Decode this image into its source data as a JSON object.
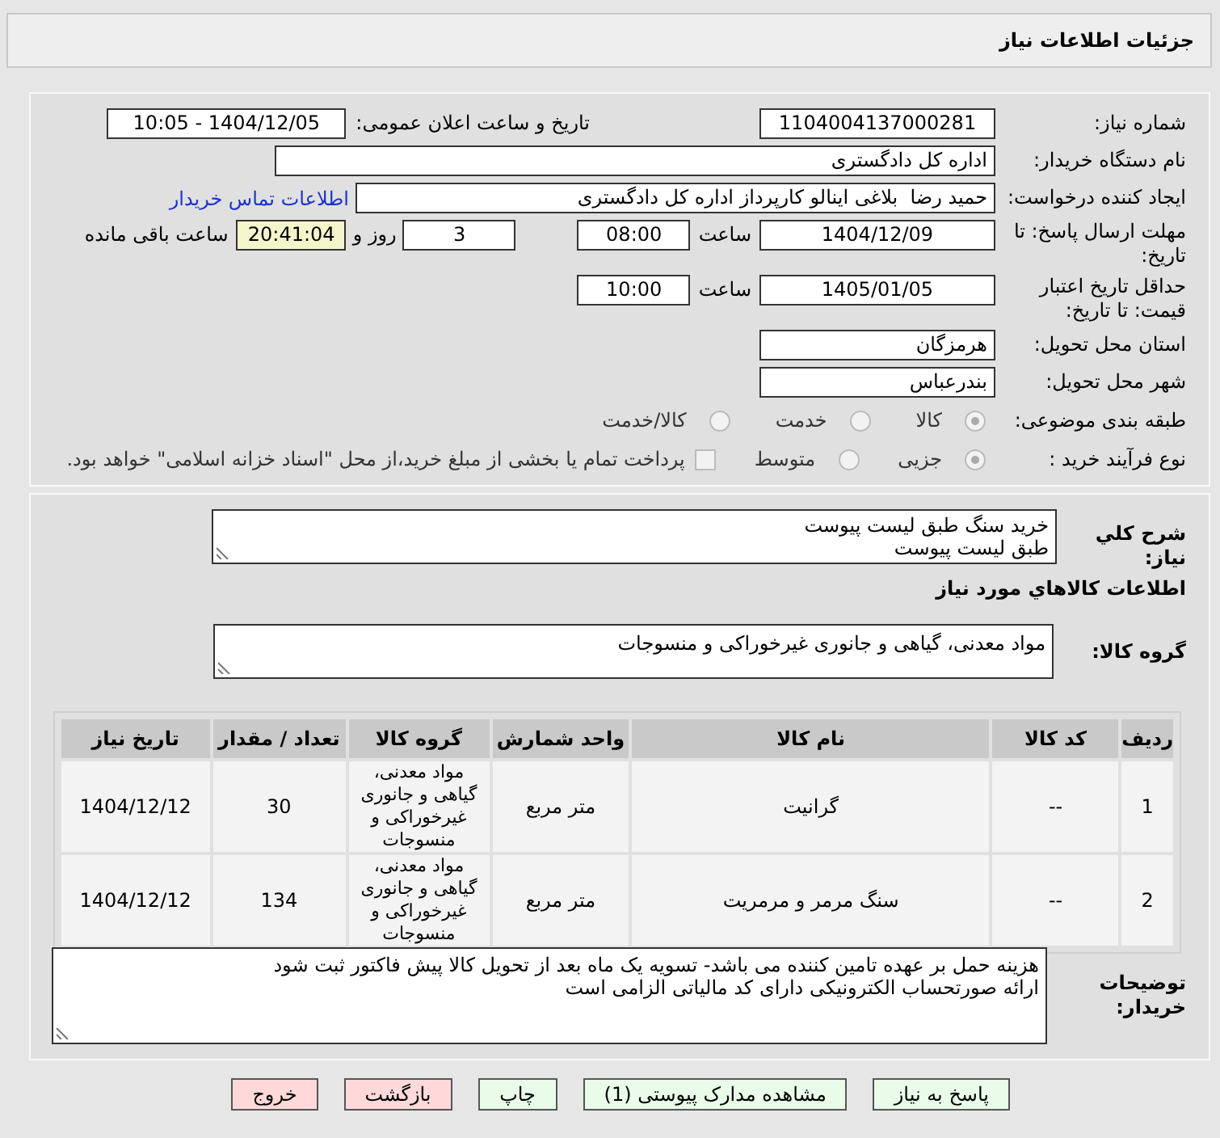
{
  "header": {
    "title": "جزئیات اطلاعات نیاز"
  },
  "need_number": {
    "label": "شماره نیاز:",
    "value": "1104004137000281"
  },
  "announce": {
    "label": "تاریخ و ساعت اعلان عمومی:",
    "value": "1404/12/05 - 10:05"
  },
  "buyer_org": {
    "label": "نام دستگاه خریدار:",
    "value": "اداره کل دادگستری"
  },
  "requester": {
    "label": "ایجاد کننده درخواست:",
    "value": "حمید رضا  بلاغی اینالو کارپرداز اداره کل دادگستری",
    "link": "اطلاعات تماس خریدار"
  },
  "deadline": {
    "label": "مهلت ارسال پاسخ: تا تاریخ:",
    "date": "1404/12/09",
    "time_label": "ساعت",
    "time": "08:00",
    "days": "3",
    "days_label": "روز و",
    "remaining": "20:41:04",
    "remaining_label": "ساعت باقی مانده"
  },
  "validity": {
    "label": "حداقل تاریخ اعتبار قیمت: تا تاریخ:",
    "date": "1405/01/05",
    "time_label": "ساعت",
    "time": "10:00"
  },
  "province": {
    "label": "استان محل تحویل:",
    "value": "هرمزگان"
  },
  "city": {
    "label": "شهر محل تحویل:",
    "value": "بندرعباس"
  },
  "category": {
    "label": "طبقه بندی موضوعی:",
    "options": [
      {
        "label": "کالا",
        "selected": true
      },
      {
        "label": "خدمت",
        "selected": false
      },
      {
        "label": "کالا/خدمت",
        "selected": false
      }
    ]
  },
  "process": {
    "label": "نوع فرآیند خرید :",
    "options": [
      {
        "label": "جزیی",
        "selected": true
      },
      {
        "label": "متوسط",
        "selected": false
      }
    ],
    "treasury": {
      "checked": false,
      "text": "پرداخت تمام یا بخشی از مبلغ خرید،از محل \"اسناد خزانه اسلامی\" خواهد بود."
    }
  },
  "description": {
    "label": "شرح کلي نياز:",
    "lines": [
      "خرید سنگ طبق لیست پیوست",
      "طبق لیست پیوست"
    ]
  },
  "goods_title": "اطلاعات كالاهاي مورد نياز",
  "goods_group": {
    "label": "گروه كالا:",
    "value": "مواد معدنی، گیاهی و جانوری غیرخوراکی و منسوجات"
  },
  "table": {
    "columns": [
      "ردیف",
      "کد کالا",
      "نام کالا",
      "واحد شمارش",
      "گروه کالا",
      "تعداد / مقدار",
      "تاریخ نیاز"
    ],
    "rows": [
      [
        "1",
        "--",
        "گرانیت",
        "متر مربع",
        "مواد معدنی، گیاهی و جانوری غیرخوراکی و منسوجات",
        "30",
        "1404/12/12"
      ],
      [
        "2",
        "--",
        "سنگ مرمر و مرمریت",
        "متر مربع",
        "مواد معدنی، گیاهی و جانوری غیرخوراکی و منسوجات",
        "134",
        "1404/12/12"
      ]
    ]
  },
  "notes": {
    "label": "توضیحات خریدار:",
    "lines": [
      "هزینه حمل بر عهده تامین کننده می باشد- تسویه یک ماه بعد از تحویل کالا پیش فاکتور ثبت شود",
      "ارائه صورتحساب الکترونیکی دارای کد مالیاتی الزامی است"
    ]
  },
  "buttons": [
    {
      "label": "پاسخ به نیاز",
      "kind": "green"
    },
    {
      "label": "مشاهده مدارک پیوستی (1)",
      "kind": "green"
    },
    {
      "label": "چاپ",
      "kind": "green"
    },
    {
      "label": "بازگشت",
      "kind": "red"
    },
    {
      "label": "خروج",
      "kind": "red"
    }
  ]
}
